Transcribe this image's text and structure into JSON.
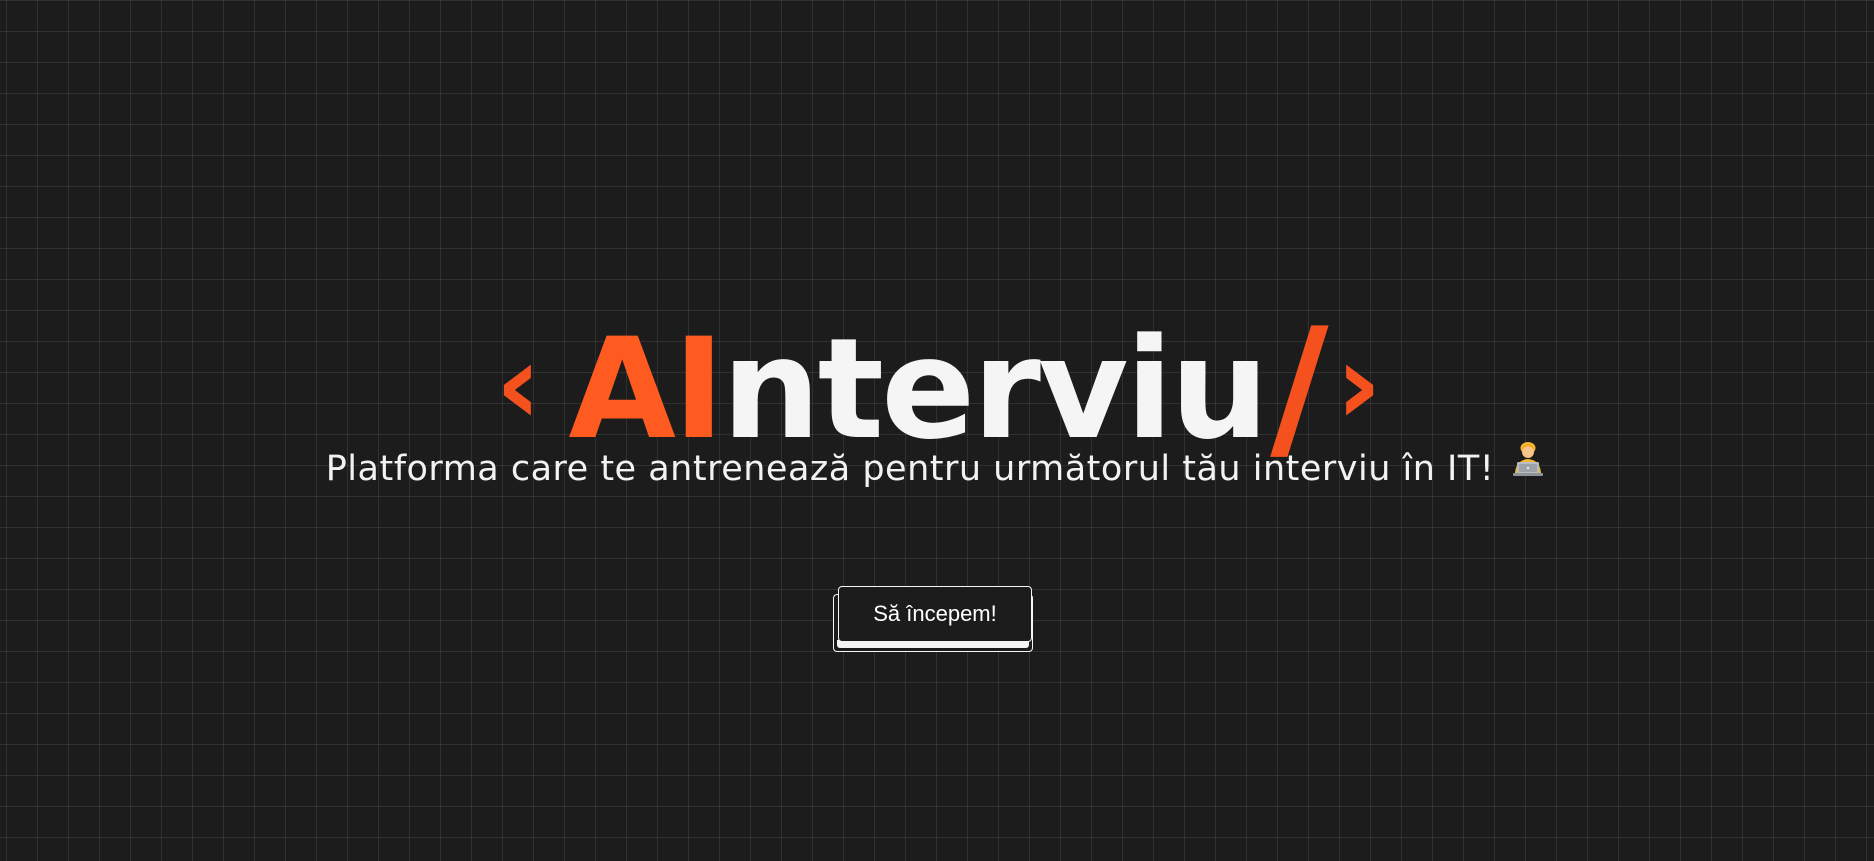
{
  "logo": {
    "open_bracket": "‹",
    "accent": "AI",
    "rest": "nterviu",
    "slash": "/",
    "close_bracket": "›"
  },
  "tagline": {
    "text": "Platforma care te antrenează pentru următorul tău interviu în IT!",
    "emoji_icon": "person-at-laptop-icon"
  },
  "cta": {
    "label": "Să începem!"
  },
  "colors": {
    "background": "#1c1c1c",
    "accent": "#ff5a1f",
    "text": "#f5f5f5",
    "grid_line": "#2e2e2e"
  }
}
